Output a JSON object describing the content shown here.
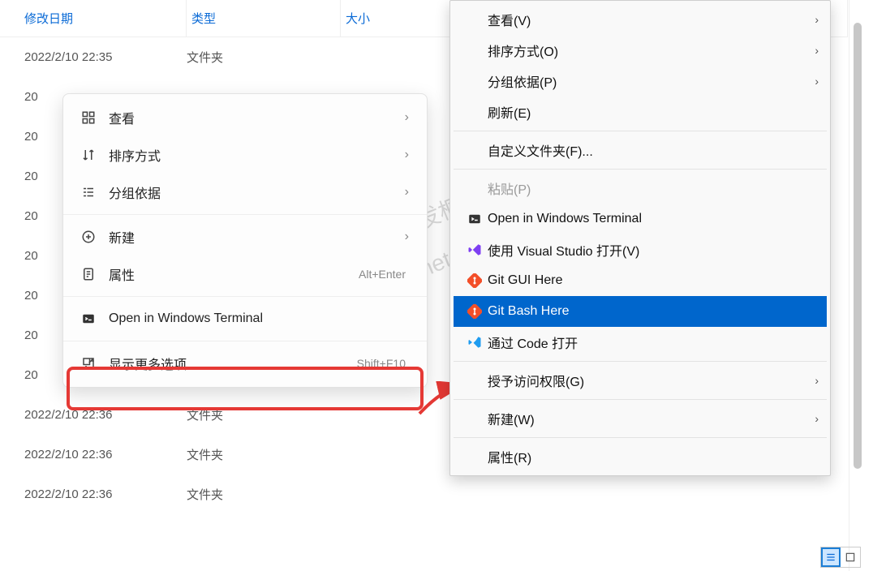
{
  "columns": {
    "date": "修改日期",
    "type": "类型",
    "size": "大小"
  },
  "rows": [
    {
      "date": "2022/2/10 22:35",
      "type": "文件夹"
    },
    {
      "date": "20",
      "type": ""
    },
    {
      "date": "20",
      "type": ""
    },
    {
      "date": "20",
      "type": ""
    },
    {
      "date": "20",
      "type": ""
    },
    {
      "date": "20",
      "type": ""
    },
    {
      "date": "20",
      "type": ""
    },
    {
      "date": "20",
      "type": ""
    },
    {
      "date": "20",
      "type": ""
    },
    {
      "date": "2022/2/10 22:36",
      "type": "文件夹"
    },
    {
      "date": "2022/2/10 22:36",
      "type": "文件夹"
    },
    {
      "date": "2022/2/10 22:36",
      "type": "文件夹"
    }
  ],
  "menu1": {
    "view": "查看",
    "sort": "排序方式",
    "group": "分组依据",
    "new": "新建",
    "properties": "属性",
    "properties_accel": "Alt+Enter",
    "terminal": "Open in Windows Terminal",
    "more": "显示更多选项",
    "more_accel": "Shift+F10"
  },
  "menu2": {
    "view": "查看(V)",
    "sort": "排序方式(O)",
    "group": "分组依据(P)",
    "refresh": "刷新(E)",
    "customize": "自定义文件夹(F)...",
    "paste": "粘贴(P)",
    "terminal": "Open in Windows Terminal",
    "vs": "使用 Visual Studio 打开(V)",
    "gitgui": "Git GUI Here",
    "gitbash": "Git Bash Here",
    "code": "通过 Code 打开",
    "grant": "授予访问权限(G)",
    "new": "新建(W)",
    "properties": "属性(R)"
  },
  "watermark": {
    "line1": "YES dotnet开发框架",
    "line2": "www.yesdotnet.com"
  }
}
